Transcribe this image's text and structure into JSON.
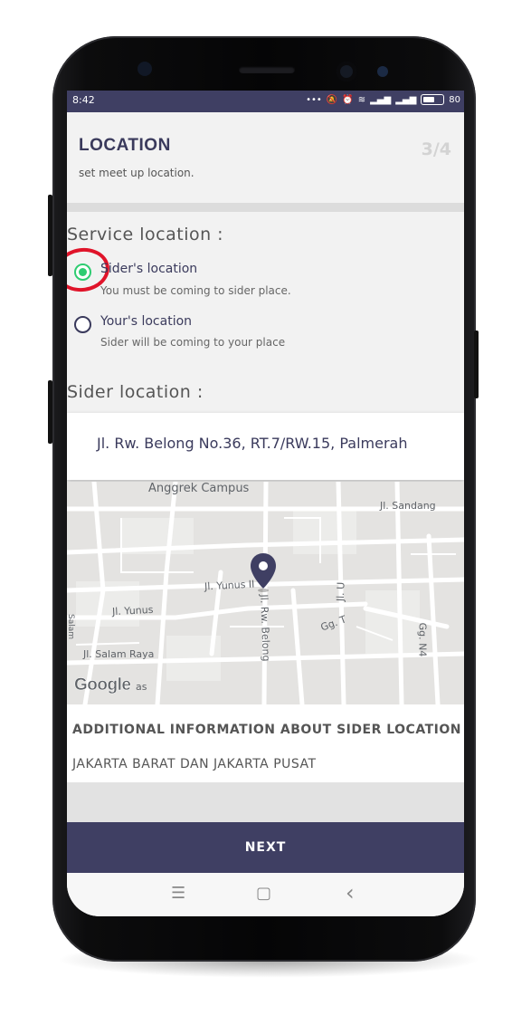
{
  "status_bar": {
    "time": "8:42",
    "icons": [
      "dots-icon",
      "mute-icon",
      "alarm-icon",
      "wifi-icon",
      "signal-icon",
      "signal-icon",
      "battery-icon"
    ],
    "battery_text": "80"
  },
  "header": {
    "title": "LOCATION",
    "subtitle": "set meet up location.",
    "step": "3/4"
  },
  "service": {
    "label": "Service location :",
    "options": [
      {
        "title": "Sider's location",
        "description": "You must be coming to sider place.",
        "selected": true
      },
      {
        "title": "Your's location",
        "description": "Sider will be coming to your place",
        "selected": false
      }
    ]
  },
  "sider_location": {
    "label": "Sider location :",
    "address": "Jl. Rw. Belong No.36, RT.7/RW.15, Palmerah"
  },
  "map": {
    "labels": {
      "campus": "Anggrek Campus",
      "sandang": "Jl. Sandang",
      "yunus_ii": "Jl. Yunus II",
      "yunus": "Jl. Yunus",
      "rw_belong": "Jl. Rw. Belong",
      "jl_u": "Jl. U",
      "gg_t": "Gg. T",
      "gg_n4": "Gg. N4",
      "salam": "Salam",
      "salam_raya": "Jl. Salam Raya",
      "as": "as"
    },
    "google": "Google",
    "colors": {
      "background": "#e4e3e1",
      "road": "#ffffff",
      "pin": "#3f3f63"
    }
  },
  "additional": {
    "title": "ADDITIONAL INFORMATION ABOUT SIDER LOCATION",
    "value": "JAKARTA BARAT DAN JAKARTA PUSAT"
  },
  "next_button": "NEXT",
  "nav_bar": {
    "menu_icon": "☰",
    "home_icon": "▢",
    "back_icon": "‹"
  },
  "colors": {
    "primary": "#3f3f63",
    "selected_radio": "#2ecc71",
    "highlight_ring": "#e0142a"
  }
}
